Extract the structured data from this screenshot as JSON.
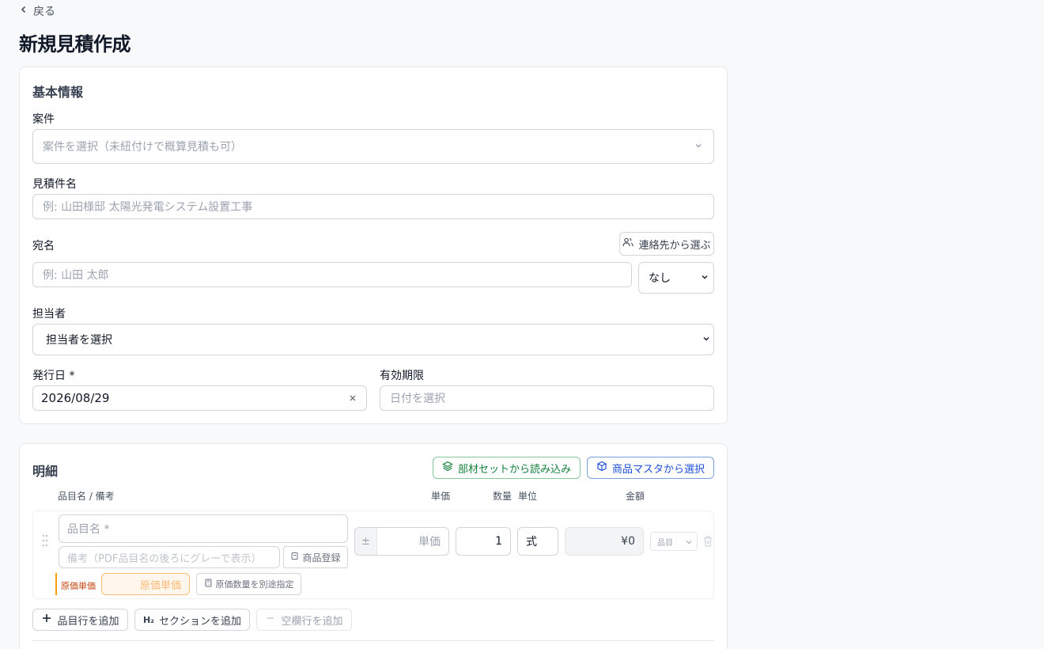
{
  "nav": {
    "back_label": "戻る"
  },
  "page": {
    "title": "新規見積作成"
  },
  "basic": {
    "section_title": "基本情報",
    "project": {
      "label": "案件",
      "placeholder": "案件を選択（未紐付けで概算見積も可）"
    },
    "estimate_name": {
      "label": "見積件名",
      "placeholder": "例: 山田様邸 太陽光発電システム設置工事"
    },
    "recipient": {
      "label": "宛名",
      "placeholder": "例: 山田 太郎",
      "contact_button": "連絡先から選ぶ",
      "honorific_value": "なし"
    },
    "assignee": {
      "label": "担当者",
      "value": "担当者を選択"
    },
    "issue_date": {
      "label": "発行日 *",
      "value": "2026/08/29"
    },
    "expiry": {
      "label": "有効期限",
      "placeholder": "日付を選択"
    }
  },
  "details": {
    "section_title": "明細",
    "load_set_button": "部材セットから読み込み",
    "product_master_button": "商品マスタから選択",
    "columns": {
      "name": "品目名 / 備考",
      "unit_price": "単価",
      "quantity": "数量",
      "unit": "単位",
      "amount": "金額"
    },
    "row": {
      "name_placeholder": "品目名 *",
      "note_placeholder": "備考（PDF品目名の後ろにグレーで表示）",
      "register_button": "商品登録",
      "price_sign": "±",
      "unit_price_placeholder": "単価",
      "quantity": "1",
      "unit": "式",
      "amount": "¥0",
      "type_value": "品目",
      "cost_label": "原価単価",
      "cost_placeholder": "原価単価",
      "cost_qty_button": "原価数量を別途指定"
    },
    "add_item_button": "品目行を追加",
    "add_section_button": "セクションを追加",
    "add_section_icon_text": "H₂",
    "add_blank_button": "空欄行を追加"
  }
}
